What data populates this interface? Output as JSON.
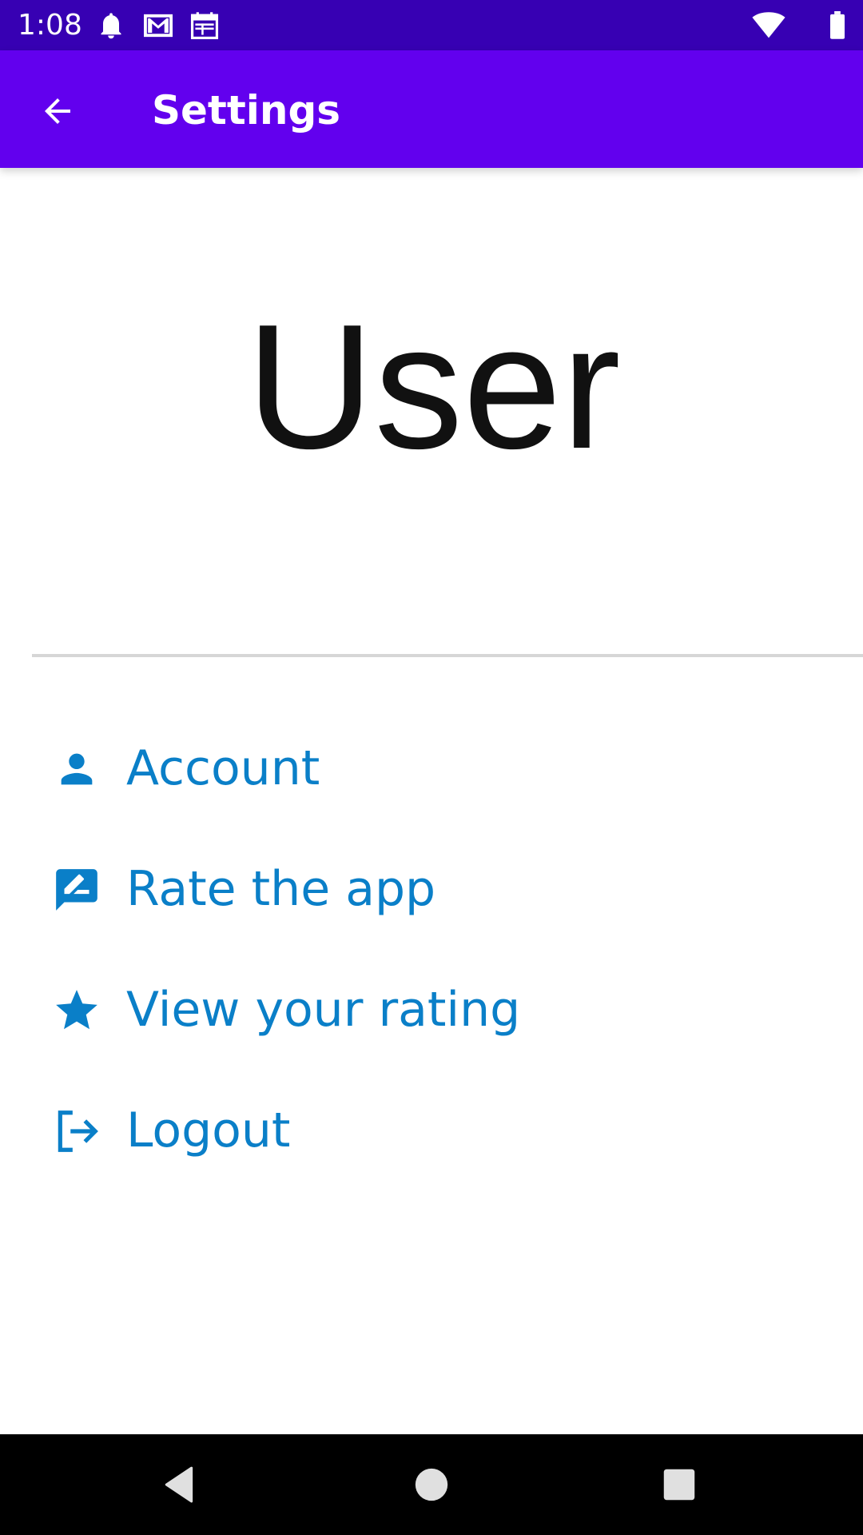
{
  "status_bar": {
    "time": "1:08",
    "icons": [
      "notification-bell-icon",
      "gmail-icon",
      "calendar-icon",
      "wifi-icon",
      "battery-icon"
    ]
  },
  "app_bar": {
    "title": "Settings",
    "back_icon": "arrow-back-icon",
    "color": "#6200ee"
  },
  "profile": {
    "logo_text": "User"
  },
  "menu": {
    "accent_color": "#0a7fc8",
    "items": [
      {
        "label": "Account",
        "icon": "person-icon"
      },
      {
        "label": "Rate the app",
        "icon": "rate-review-icon"
      },
      {
        "label": "View your rating",
        "icon": "star-icon"
      },
      {
        "label": "Logout",
        "icon": "logout-icon"
      }
    ]
  },
  "nav_bar": {
    "buttons": [
      "back-triangle-icon",
      "home-circle-icon",
      "recents-square-icon"
    ]
  }
}
